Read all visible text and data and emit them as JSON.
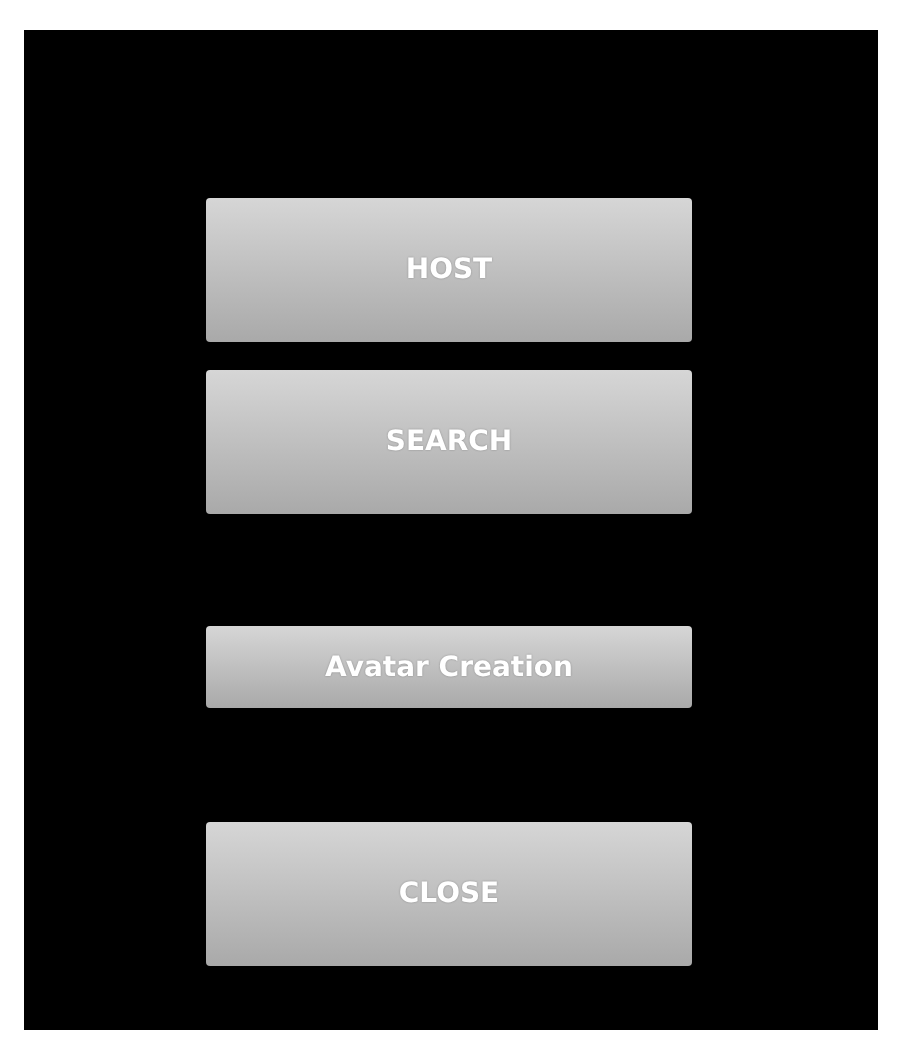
{
  "buttons": [
    {
      "label": "HOST",
      "kind": "large"
    },
    {
      "label": "SEARCH",
      "kind": "large"
    },
    {
      "label": "Avatar Creation",
      "kind": "small"
    },
    {
      "label": "CLOSE",
      "kind": "large"
    }
  ]
}
